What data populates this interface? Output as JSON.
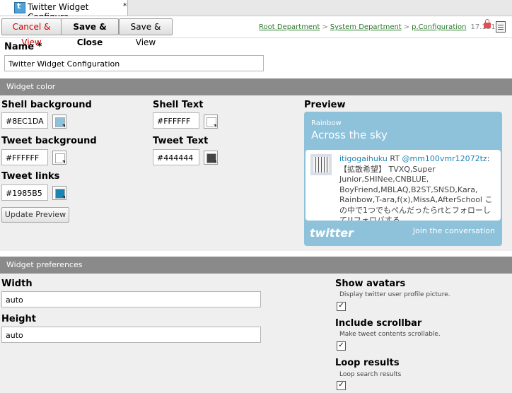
{
  "tab": {
    "title": "Twitter Widget Configura...",
    "dirty_marker": "*"
  },
  "toolbar": {
    "cancel_view": "Cancel & View",
    "save_close": "Save & Close",
    "save_view": "Save & View"
  },
  "breadcrumb": {
    "items": [
      "Root Department",
      "System Department",
      "p.Configuration"
    ],
    "version": "17.151"
  },
  "name": {
    "label": "Name *",
    "value": "Twitter Widget Configuration"
  },
  "widget_color": {
    "header": "Widget color",
    "shell_background": {
      "label": "Shell background",
      "value": "#8EC1DA",
      "swatch": "#8ec1da"
    },
    "shell_text": {
      "label": "Shell Text",
      "value": "#FFFFFF",
      "swatch": "#ffffff"
    },
    "tweet_background": {
      "label": "Tweet background",
      "value": "#FFFFFF",
      "swatch": "#ffffff"
    },
    "tweet_text": {
      "label": "Tweet Text",
      "value": "#444444",
      "swatch": "#444444"
    },
    "tweet_links": {
      "label": "Tweet links",
      "value": "#1985B5",
      "swatch": "#1985b5"
    },
    "update_button": "Update Preview"
  },
  "preview": {
    "label": "Preview",
    "subtitle": "Rainbow",
    "title": "Across the sky",
    "tweet_user": "itigogaihuku",
    "tweet_rt": "RT",
    "tweet_mention": "@mm100vmr12072tz",
    "tweet_body": ":【拡散希望】 TVXQ,Super Junior,SHINee,CNBLUE, BoyFriend,MBLAQ,B2ST,SNSD,Kara, Rainbow,T-ara,f(x),MissA,AfterSchool この中で1つでもぺんだったらrtとフォローして!!フォロバする",
    "logo": "twitter",
    "join": "Join the conversation"
  },
  "widget_prefs": {
    "header": "Widget preferences",
    "width": {
      "label": "Width",
      "value": "auto"
    },
    "height": {
      "label": "Height",
      "value": "auto"
    },
    "show_avatars": {
      "label": "Show avatars",
      "help": "Display twitter user profile picture.",
      "checked": true
    },
    "include_scrollbar": {
      "label": "Include scrollbar",
      "help": "Make tweet contents scrollable.",
      "checked": true
    },
    "loop_results": {
      "label": "Loop results",
      "help": "Loop search results",
      "checked": true
    },
    "check_mark": "✓"
  },
  "colors": {
    "accent": "#8ec1da",
    "link": "#1985b5",
    "cancel": "#cc0000",
    "breadcrumb": "#2a7a2a"
  }
}
